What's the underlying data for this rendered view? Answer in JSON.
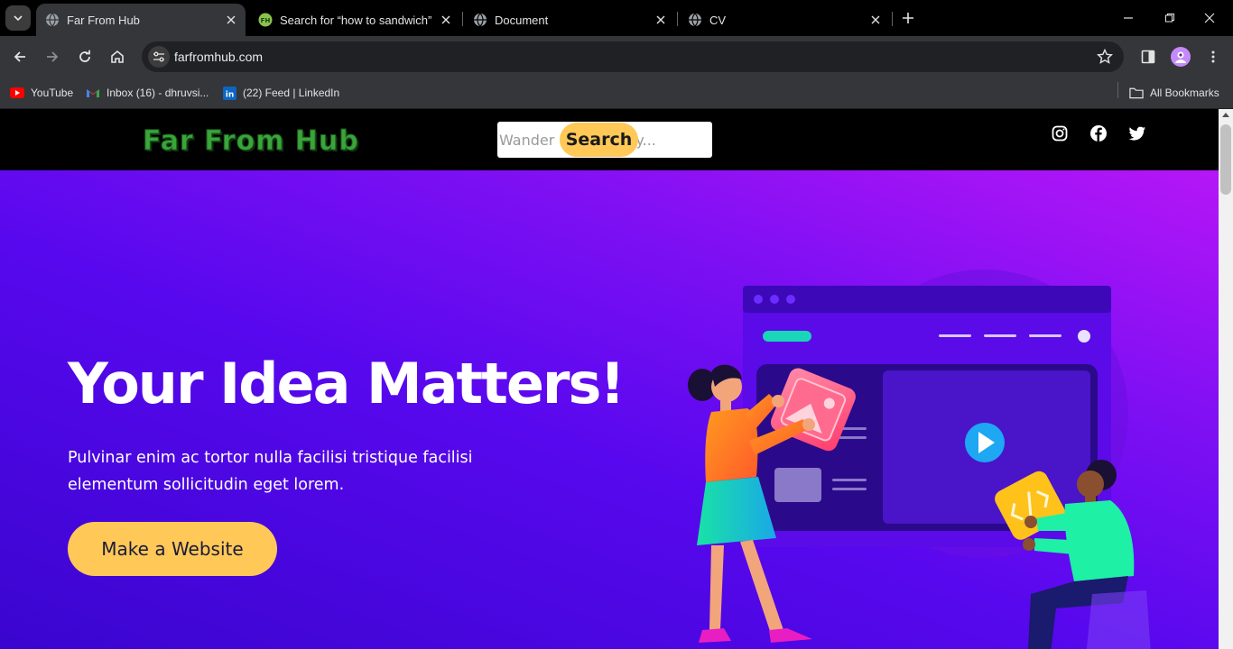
{
  "browser": {
    "tabs": [
      {
        "title": "Far From Hub",
        "active": true
      },
      {
        "title": "Search for “how to sandwich” -",
        "active": false
      },
      {
        "title": "Document",
        "active": false
      },
      {
        "title": "CV",
        "active": false
      }
    ],
    "address": "farfromhub.com",
    "bookmarks": [
      {
        "label": "YouTube",
        "icon": "youtube-icon"
      },
      {
        "label": "Inbox (16) - dhruvsi...",
        "icon": "gmail-icon"
      },
      {
        "label": "(22) Feed | LinkedIn",
        "icon": "linkedin-icon"
      }
    ],
    "all_bookmarks": "All Bookmarks"
  },
  "site": {
    "logo_text": "Far From Hub",
    "search": {
      "placeholder": "Wander at Your Way...",
      "button": "Search"
    },
    "social": [
      "instagram-icon",
      "facebook-icon",
      "twitter-icon"
    ]
  },
  "hero": {
    "title": "Your Idea Matters!",
    "subtitle": "Pulvinar enim ac tortor nulla facilisi tristique facilisi elementum sollicitudin eget lorem.",
    "cta": "Make a Website"
  },
  "colors": {
    "accent": "#ffc857",
    "hero_gradient_start": "#b516f7",
    "hero_gradient_end": "#3a05cf",
    "logo_green": "#3aa53a"
  }
}
